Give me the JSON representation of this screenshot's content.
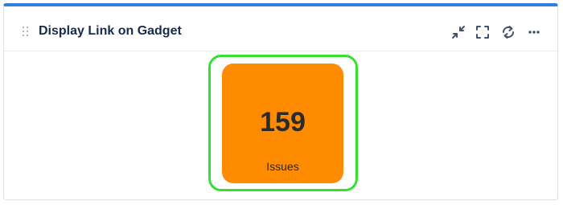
{
  "gadget": {
    "title": "Display Link on Gadget",
    "accent_color": "#2f7fe0",
    "toolbar": {
      "icons": [
        "minimize-icon",
        "fullscreen-icon",
        "refresh-icon",
        "more-icon"
      ]
    },
    "tile": {
      "count": "159",
      "label": "Issues",
      "color": "#ff8b00",
      "highlight_color": "#33e033"
    }
  }
}
